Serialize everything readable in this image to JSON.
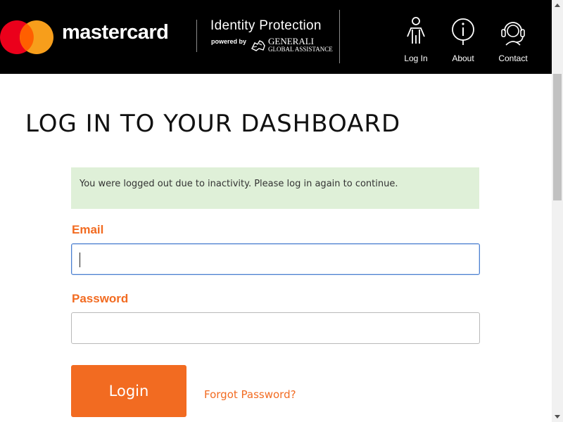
{
  "header": {
    "brand": "mastercard",
    "product": "Identity Protection",
    "powered_by": "powered by",
    "partner_name": "GENERALI",
    "partner_sub": "GLOBAL ASSISTANCE",
    "nav": [
      {
        "label": "Log In",
        "icon": "person-icon"
      },
      {
        "label": "About",
        "icon": "info-icon"
      },
      {
        "label": "Contact",
        "icon": "headset-icon"
      }
    ]
  },
  "main": {
    "title": "LOG IN TO YOUR DASHBOARD",
    "alert": "You were logged out due to inactivity. Please log in again to continue.",
    "email_label": "Email",
    "email_value": "",
    "password_label": "Password",
    "password_value": "",
    "login_button": "Login",
    "forgot_link": "Forgot Password?"
  },
  "colors": {
    "accent": "#f26b21",
    "header_bg": "#000000",
    "alert_bg": "#dff0d8",
    "mc_red": "#eb001b",
    "mc_orange": "#f79e1b"
  }
}
